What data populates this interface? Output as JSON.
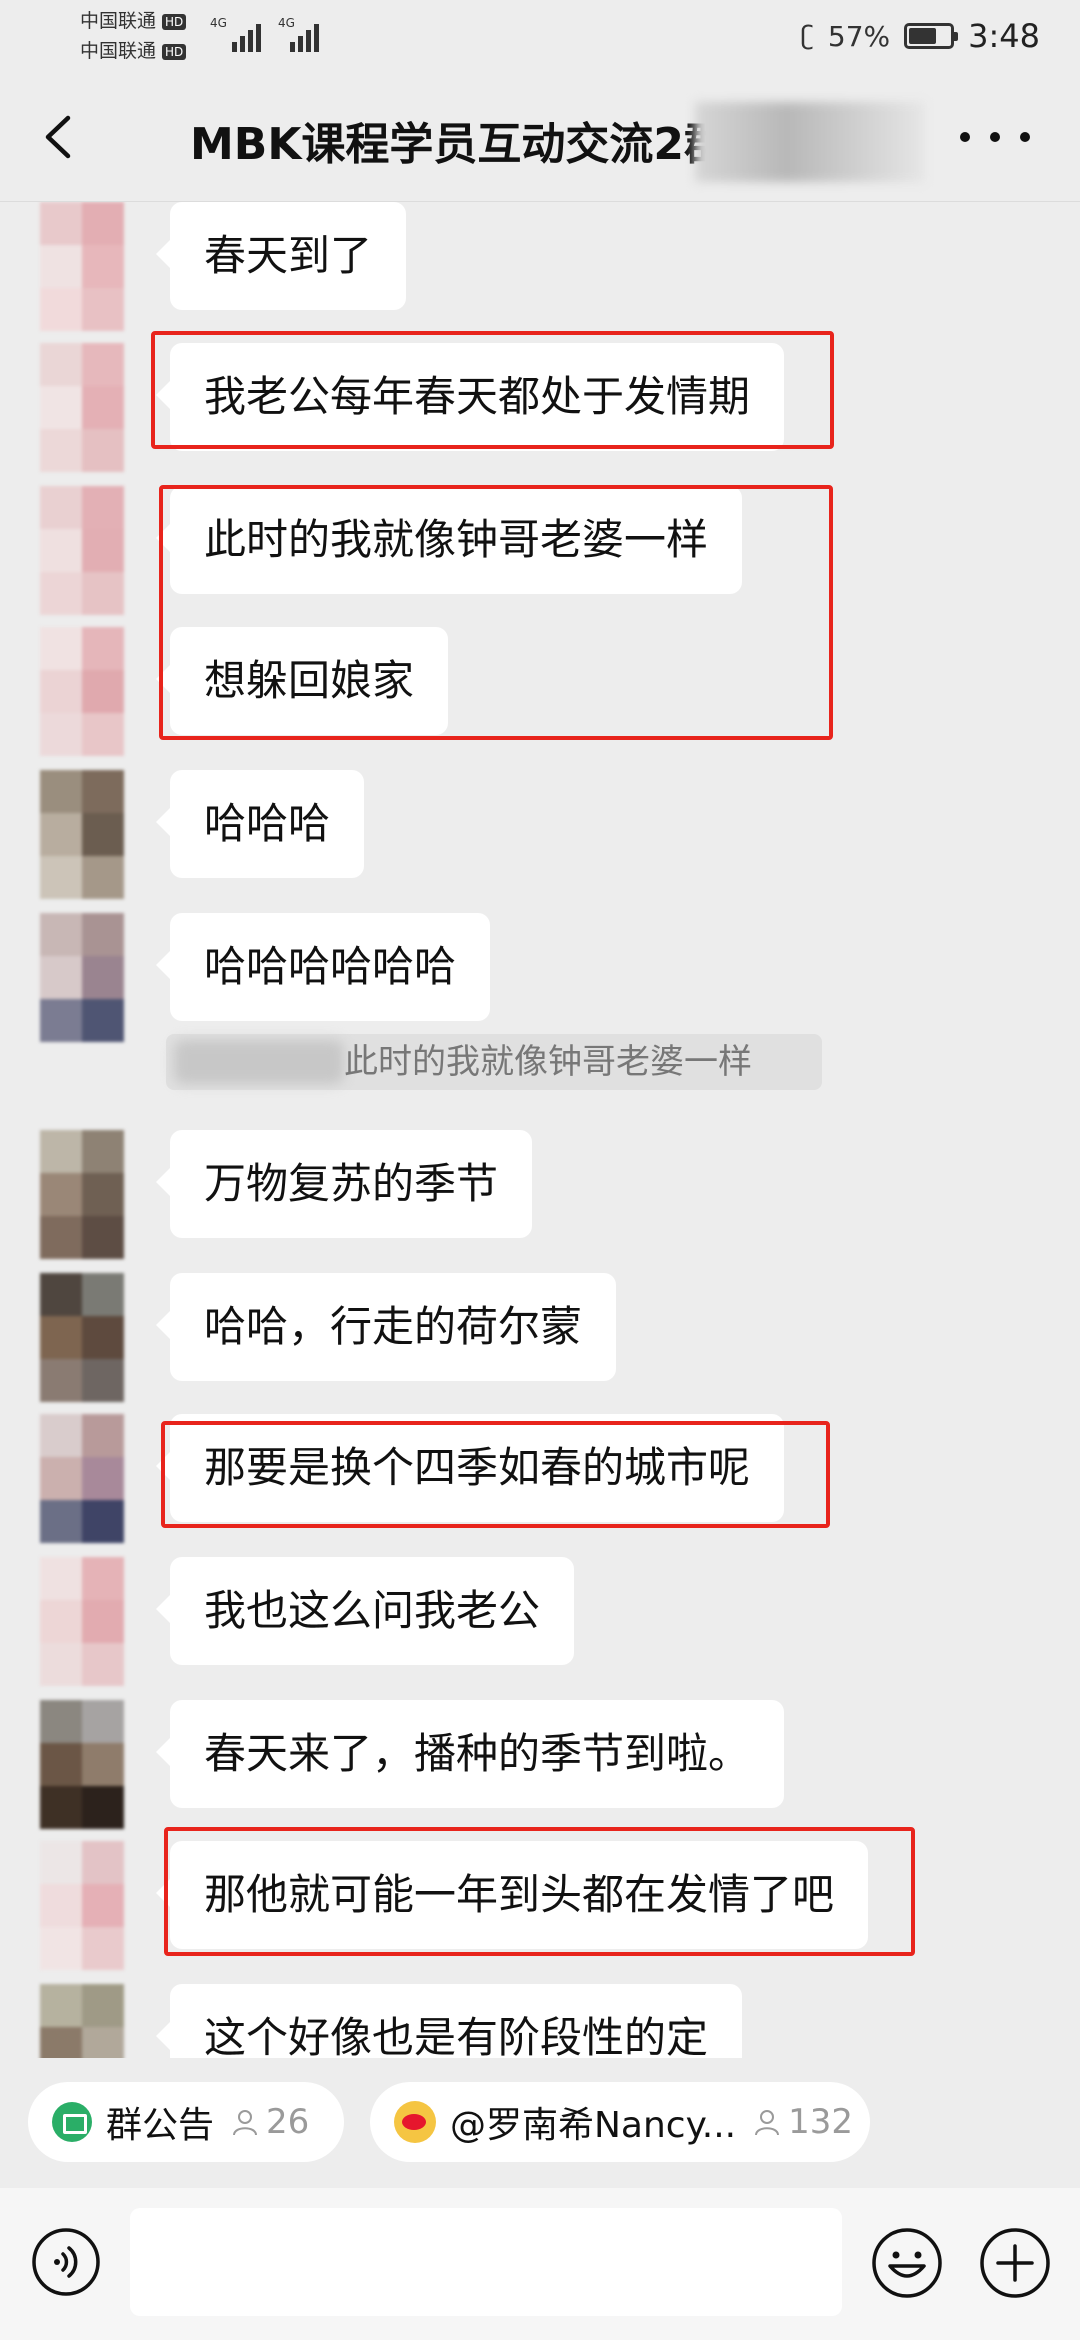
{
  "status_bar": {
    "carrier1": "中国联通",
    "carrier2": "中国联通",
    "hd_badge": "HD",
    "network1": "4G",
    "network2": "4G",
    "battery": "57%",
    "time": "3:48"
  },
  "header": {
    "title": "MBK课程学员互动交流2群"
  },
  "messages": [
    {
      "text": "春天到了"
    },
    {
      "text": "我老公每年春天都处于发情期"
    },
    {
      "text": "此时的我就像钟哥老婆一样"
    },
    {
      "text": "想躲回娘家"
    },
    {
      "text": "哈哈哈"
    },
    {
      "text": "哈哈哈哈哈哈"
    },
    {
      "text": "万物复苏的季节"
    },
    {
      "text": "哈哈，行走的荷尔蒙"
    },
    {
      "text": "那要是换个四季如春的城市呢"
    },
    {
      "text": "我也这么问我老公"
    },
    {
      "text": "春天来了，播种的季节到啦。"
    },
    {
      "text": "那他就可能一年到头都在发情了吧"
    },
    {
      "text": "这个好像也是有阶段性的定"
    }
  ],
  "quote": {
    "text": "此时的我就像钟哥老婆一样"
  },
  "bottom": {
    "notice_label": "群公告",
    "notice_count": "26",
    "weibo_label": "@罗南希Nancy...",
    "weibo_count": "132",
    "input_placeholder": ""
  },
  "colors": {
    "background": "#ededed",
    "bubble": "#ffffff",
    "highlight": "#e8241c",
    "notice_green": "#2aae67"
  }
}
